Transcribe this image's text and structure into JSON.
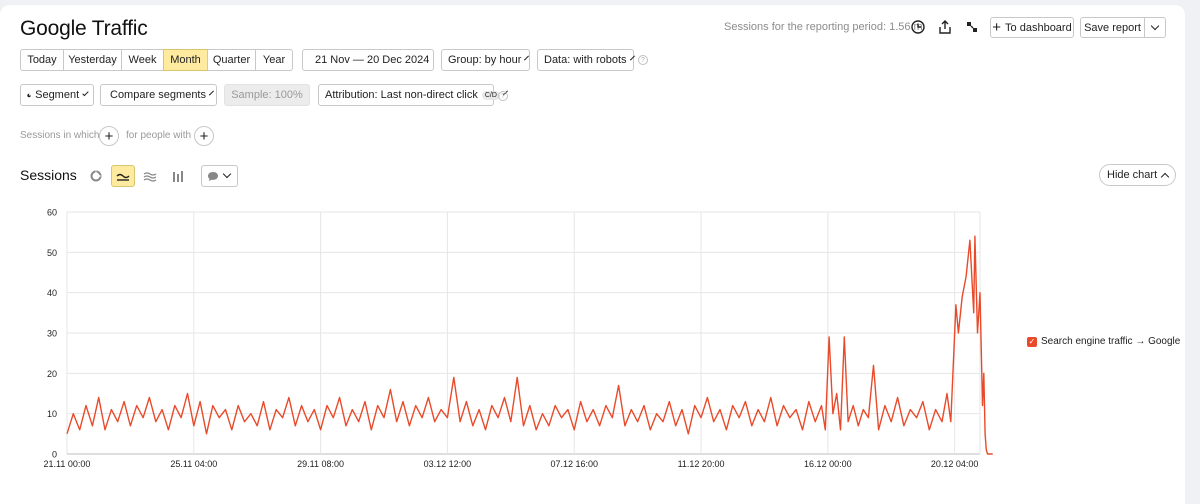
{
  "report": {
    "title": "Google Traffic",
    "period_note": "Sessions for the reporting period: 1.56 m"
  },
  "header_actions": {
    "to_dashboard": "To dashboard",
    "save_report": "Save report"
  },
  "period_tabs": [
    {
      "label": "Today",
      "active": false
    },
    {
      "label": "Yesterday",
      "active": false
    },
    {
      "label": "Week",
      "active": false
    },
    {
      "label": "Month",
      "active": true
    },
    {
      "label": "Quarter",
      "active": false
    },
    {
      "label": "Year",
      "active": false
    }
  ],
  "filters": {
    "date_range": "21 Nov — 20 Dec 2024",
    "group": "Group: by hour",
    "data": "Data: with robots"
  },
  "segment_bar": {
    "segment": "Segment",
    "compare": "Compare segments",
    "sample": "Sample: 100%",
    "attribution": "Attribution: Last non-direct click",
    "attribution_badge": "C/D"
  },
  "condition": {
    "sessions_in_which": "Sessions in which",
    "for_people_with": "for people with"
  },
  "chart_section": {
    "label": "Sessions",
    "hide_chart": "Hide chart"
  },
  "colors": {
    "accent": "#ffeba0",
    "series": "#e84a2a"
  },
  "chart_data": {
    "type": "line",
    "title": "",
    "xlabel": "",
    "ylabel": "",
    "ylim": [
      0,
      60
    ],
    "yticks": [
      0,
      10,
      20,
      30,
      40,
      50,
      60
    ],
    "xticks": [
      {
        "label": "21.11 00:00",
        "hour": 0
      },
      {
        "label": "25.11 04:00",
        "hour": 100
      },
      {
        "label": "29.11 08:00",
        "hour": 200
      },
      {
        "label": "03.12 12:00",
        "hour": 300
      },
      {
        "label": "07.12 16:00",
        "hour": 400
      },
      {
        "label": "11.12 20:00",
        "hour": 500
      },
      {
        "label": "16.12 00:00",
        "hour": 600
      },
      {
        "label": "20.12 04:00",
        "hour": 700
      }
    ],
    "x_unit": "hours since 21.11 00:00",
    "x_max_hour": 720,
    "grid": true,
    "legend_position": "right",
    "series": [
      {
        "name": "Search engine traffic → Google",
        "points": [
          [
            0,
            5
          ],
          [
            5,
            10
          ],
          [
            10,
            6
          ],
          [
            15,
            12
          ],
          [
            20,
            7
          ],
          [
            25,
            14
          ],
          [
            30,
            6
          ],
          [
            35,
            11
          ],
          [
            40,
            8
          ],
          [
            45,
            13
          ],
          [
            50,
            7
          ],
          [
            55,
            12
          ],
          [
            60,
            9
          ],
          [
            65,
            14
          ],
          [
            70,
            8
          ],
          [
            75,
            11
          ],
          [
            80,
            6
          ],
          [
            85,
            12
          ],
          [
            90,
            9
          ],
          [
            95,
            15
          ],
          [
            100,
            7
          ],
          [
            105,
            13
          ],
          [
            110,
            5
          ],
          [
            115,
            12
          ],
          [
            120,
            9
          ],
          [
            125,
            11
          ],
          [
            130,
            6
          ],
          [
            135,
            12
          ],
          [
            140,
            8
          ],
          [
            145,
            10
          ],
          [
            150,
            7
          ],
          [
            155,
            13
          ],
          [
            160,
            6
          ],
          [
            165,
            11
          ],
          [
            170,
            9
          ],
          [
            175,
            14
          ],
          [
            180,
            7
          ],
          [
            185,
            12
          ],
          [
            190,
            8
          ],
          [
            195,
            11
          ],
          [
            200,
            6
          ],
          [
            205,
            12
          ],
          [
            210,
            9
          ],
          [
            215,
            14
          ],
          [
            220,
            7
          ],
          [
            225,
            11
          ],
          [
            230,
            8
          ],
          [
            235,
            13
          ],
          [
            240,
            6
          ],
          [
            245,
            12
          ],
          [
            250,
            9
          ],
          [
            255,
            16
          ],
          [
            260,
            8
          ],
          [
            265,
            13
          ],
          [
            270,
            7
          ],
          [
            275,
            12
          ],
          [
            280,
            9
          ],
          [
            285,
            14
          ],
          [
            290,
            8
          ],
          [
            295,
            11
          ],
          [
            300,
            9
          ],
          [
            305,
            19
          ],
          [
            310,
            8
          ],
          [
            315,
            13
          ],
          [
            320,
            7
          ],
          [
            325,
            11
          ],
          [
            330,
            6
          ],
          [
            335,
            12
          ],
          [
            340,
            9
          ],
          [
            345,
            14
          ],
          [
            350,
            8
          ],
          [
            355,
            19
          ],
          [
            360,
            7
          ],
          [
            365,
            12
          ],
          [
            370,
            6
          ],
          [
            375,
            10
          ],
          [
            380,
            7
          ],
          [
            385,
            12
          ],
          [
            390,
            9
          ],
          [
            395,
            11
          ],
          [
            400,
            6
          ],
          [
            405,
            13
          ],
          [
            410,
            8
          ],
          [
            415,
            11
          ],
          [
            420,
            7
          ],
          [
            425,
            12
          ],
          [
            430,
            9
          ],
          [
            435,
            17
          ],
          [
            440,
            7
          ],
          [
            445,
            11
          ],
          [
            450,
            8
          ],
          [
            455,
            12
          ],
          [
            460,
            6
          ],
          [
            465,
            10
          ],
          [
            470,
            8
          ],
          [
            475,
            13
          ],
          [
            480,
            7
          ],
          [
            485,
            11
          ],
          [
            490,
            5
          ],
          [
            495,
            12
          ],
          [
            500,
            9
          ],
          [
            505,
            14
          ],
          [
            510,
            8
          ],
          [
            515,
            11
          ],
          [
            520,
            6
          ],
          [
            525,
            12
          ],
          [
            530,
            9
          ],
          [
            535,
            13
          ],
          [
            540,
            7
          ],
          [
            545,
            11
          ],
          [
            550,
            8
          ],
          [
            555,
            14
          ],
          [
            560,
            7
          ],
          [
            565,
            12
          ],
          [
            570,
            9
          ],
          [
            575,
            11
          ],
          [
            580,
            6
          ],
          [
            585,
            13
          ],
          [
            590,
            8
          ],
          [
            595,
            12
          ],
          [
            598,
            6
          ],
          [
            601,
            29
          ],
          [
            604,
            10
          ],
          [
            607,
            15
          ],
          [
            610,
            6
          ],
          [
            613,
            29
          ],
          [
            616,
            8
          ],
          [
            620,
            12
          ],
          [
            624,
            7
          ],
          [
            628,
            11
          ],
          [
            632,
            9
          ],
          [
            636,
            22
          ],
          [
            640,
            6
          ],
          [
            645,
            12
          ],
          [
            650,
            8
          ],
          [
            655,
            14
          ],
          [
            660,
            7
          ],
          [
            665,
            11
          ],
          [
            670,
            9
          ],
          [
            675,
            13
          ],
          [
            680,
            6
          ],
          [
            685,
            11
          ],
          [
            690,
            8
          ],
          [
            694,
            15
          ],
          [
            697,
            8
          ],
          [
            701,
            37
          ],
          [
            703,
            30
          ],
          [
            706,
            39
          ],
          [
            709,
            44
          ],
          [
            712,
            53
          ],
          [
            715,
            35
          ],
          [
            716,
            54
          ],
          [
            718,
            30
          ],
          [
            720,
            40
          ],
          [
            722,
            12
          ],
          [
            723,
            20
          ],
          [
            724,
            5
          ],
          [
            725,
            1
          ],
          [
            726,
            0
          ],
          [
            730,
            0
          ]
        ]
      }
    ]
  }
}
